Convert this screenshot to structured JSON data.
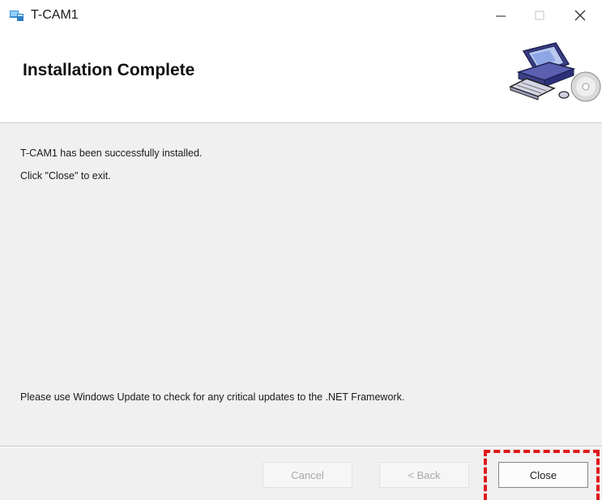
{
  "window": {
    "title": "T-CAM1",
    "app_icon": "setup-icon",
    "controls": {
      "minimize": "minimize-icon",
      "maximize": "maximize-icon",
      "close": "close-icon"
    }
  },
  "banner": {
    "title": "Installation Complete",
    "graphic": "computer-cd-icon"
  },
  "body": {
    "line1": "T-CAM1 has been successfully installed.",
    "line2": "Click \"Close\" to exit.",
    "note": "Please use Windows Update to check for any critical updates to the .NET Framework."
  },
  "footer": {
    "cancel_label": "Cancel",
    "back_label": "< Back",
    "close_label": "Close"
  },
  "colors": {
    "highlight": "#e0181b",
    "window_bg": "#f0f0f0",
    "banner_bg": "#ffffff"
  }
}
